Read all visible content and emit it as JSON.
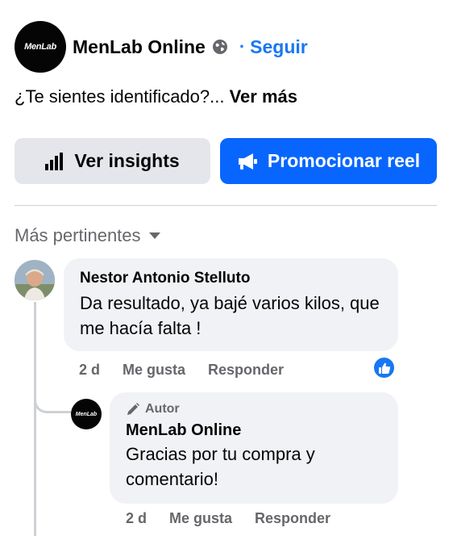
{
  "header": {
    "avatar_text": "MenLab",
    "page_name": "MenLab Online",
    "separator": "·",
    "follow_label": "Seguir"
  },
  "post": {
    "caption": "¿Te sientes identificado?... ",
    "see_more": "Ver más"
  },
  "actions": {
    "insights_label": "Ver insights",
    "promote_label": "Promocionar reel"
  },
  "comments_sort": {
    "label": "Más pertinentes"
  },
  "comments": [
    {
      "author": "Nestor Antonio Stelluto",
      "text": "Da resultado, ya bajé varios kilos, que me hacía falta !",
      "time": "2 d",
      "like_label": "Me gusta",
      "reply_label": "Responder",
      "reactions": "like",
      "replies": [
        {
          "badge": "Autor",
          "avatar_text": "MenLab",
          "author": "MenLab Online",
          "text": "Gracias por tu compra y comentario!",
          "time": "2 d",
          "like_label": "Me gusta",
          "reply_label": "Responder"
        }
      ]
    }
  ],
  "colors": {
    "accent": "#1877f2",
    "promote_button": "#0866ff",
    "secondary_button": "#e4e6eb",
    "bubble": "#f0f2f5",
    "muted_text": "#65676b"
  }
}
